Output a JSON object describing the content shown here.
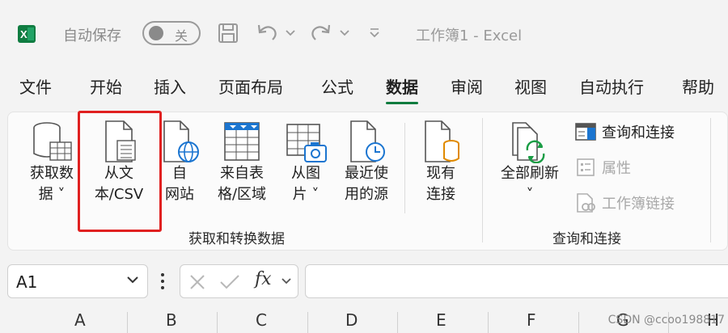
{
  "titlebar": {
    "autosave_label": "自动保存",
    "autosave_state": "关",
    "document_title": "工作簿1  -  Excel"
  },
  "menu": {
    "tabs": [
      "文件",
      "开始",
      "插入",
      "页面布局",
      "公式",
      "数据",
      "审阅",
      "视图",
      "自动执行",
      "帮助"
    ],
    "active_tab": "数据"
  },
  "ribbon": {
    "get_data": {
      "line1": "获取数",
      "line2": "据 ˅"
    },
    "from_text_csv": {
      "line1": "从文",
      "line2": "本/CSV"
    },
    "from_web": {
      "line1": "自",
      "line2": "网站"
    },
    "from_table": {
      "line1": "来自表",
      "line2": "格/区域"
    },
    "from_picture": {
      "line1": "从图",
      "line2": "片 ˅"
    },
    "recent_sources": {
      "line1": "最近使",
      "line2": "用的源"
    },
    "existing_connections": {
      "line1": "现有",
      "line2": "连接"
    },
    "group_get_transform": "获取和转换数据",
    "refresh_all": {
      "line1": "全部刷新",
      "line2": "˅"
    },
    "queries_connections": "查询和连接",
    "properties": "属性",
    "workbook_links": "工作簿链接",
    "group_queries": "查询和连接"
  },
  "formula_bar": {
    "name_box": "A1",
    "fx_label": "fx"
  },
  "columns": [
    "A",
    "B",
    "C",
    "D",
    "E",
    "F",
    "G",
    "H"
  ],
  "watermark": "CSDN @ccoo198817",
  "colors": {
    "excel_green": "#107c41",
    "active_underline": "#0f7b3e",
    "highlight_red": "#e02020",
    "disabled_text": "#a8a8a8"
  }
}
